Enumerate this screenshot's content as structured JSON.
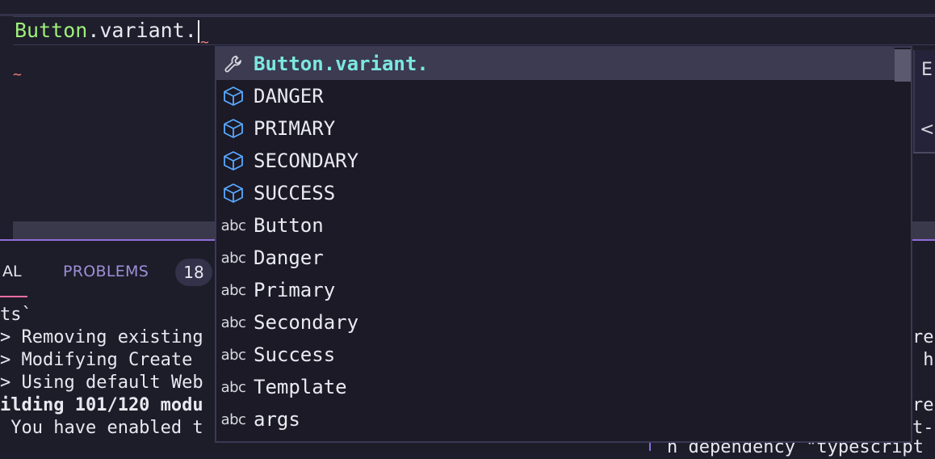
{
  "editor": {
    "identifier": "Button",
    "rest": ".variant."
  },
  "suggestions": [
    {
      "label": "Button.variant.",
      "icon": "wrench-icon",
      "selected": true
    },
    {
      "label": "DANGER",
      "icon": "cube-icon"
    },
    {
      "label": "PRIMARY",
      "icon": "cube-icon"
    },
    {
      "label": "SECONDARY",
      "icon": "cube-icon"
    },
    {
      "label": "SUCCESS",
      "icon": "cube-icon"
    },
    {
      "label": "Button",
      "icon": "abc-icon"
    },
    {
      "label": "Danger",
      "icon": "abc-icon"
    },
    {
      "label": "Primary",
      "icon": "abc-icon"
    },
    {
      "label": "Secondary",
      "icon": "abc-icon"
    },
    {
      "label": "Success",
      "icon": "abc-icon"
    },
    {
      "label": "Template",
      "icon": "abc-icon"
    },
    {
      "label": "args",
      "icon": "abc-icon"
    }
  ],
  "abc_text": "abc",
  "panel": {
    "terminal_tab": "AL",
    "problems_tab": "PROBLEMS",
    "problems_count": "18",
    "lines": [
      "ts`",
      "> Removing existing",
      "> Modifying Create",
      "> Using default Web",
      "ilding 101/120 modu",
      " You have enabled t"
    ],
    "right_lines": [
      "res",
      " ha",
      "res",
      "t-c",
      "n dependency \"typescript"
    ]
  },
  "side_pane": {
    "top": "E",
    "bottom": "<"
  },
  "colors": {
    "accent": "#8d6fd8",
    "identifier": "#9ef07a",
    "selected_suggestion": "#7de8e0",
    "cube": "#5aa8ff"
  }
}
